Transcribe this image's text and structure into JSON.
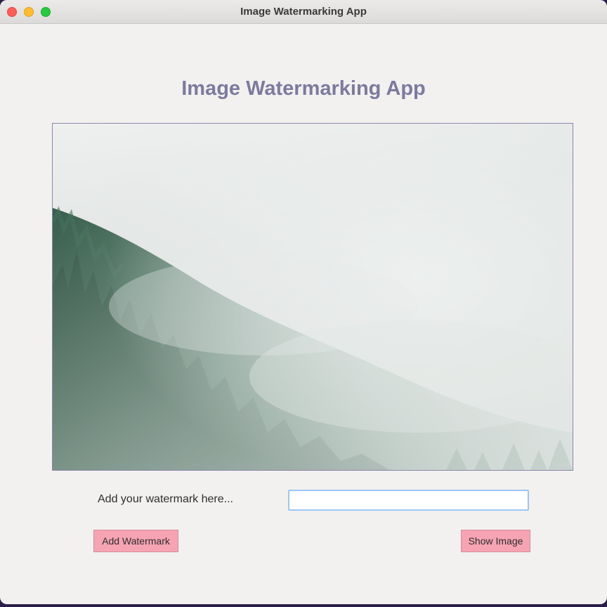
{
  "window": {
    "title": "Image Watermarking App",
    "controls": [
      "close",
      "minimize",
      "maximize"
    ]
  },
  "main": {
    "heading": "Image Watermarking App",
    "image": {
      "description_icon": "image-preview"
    },
    "watermark": {
      "label": "Add your watermark here...",
      "input_value": "",
      "input_placeholder": ""
    },
    "buttons": {
      "add_label": "Add Watermark",
      "show_label": "Show Image"
    }
  },
  "colors": {
    "heading": "#7c7a9e",
    "button_bg": "#f6a3b4",
    "input_focus_border": "#9dc7f2",
    "window_bg": "#f3f1ef"
  }
}
